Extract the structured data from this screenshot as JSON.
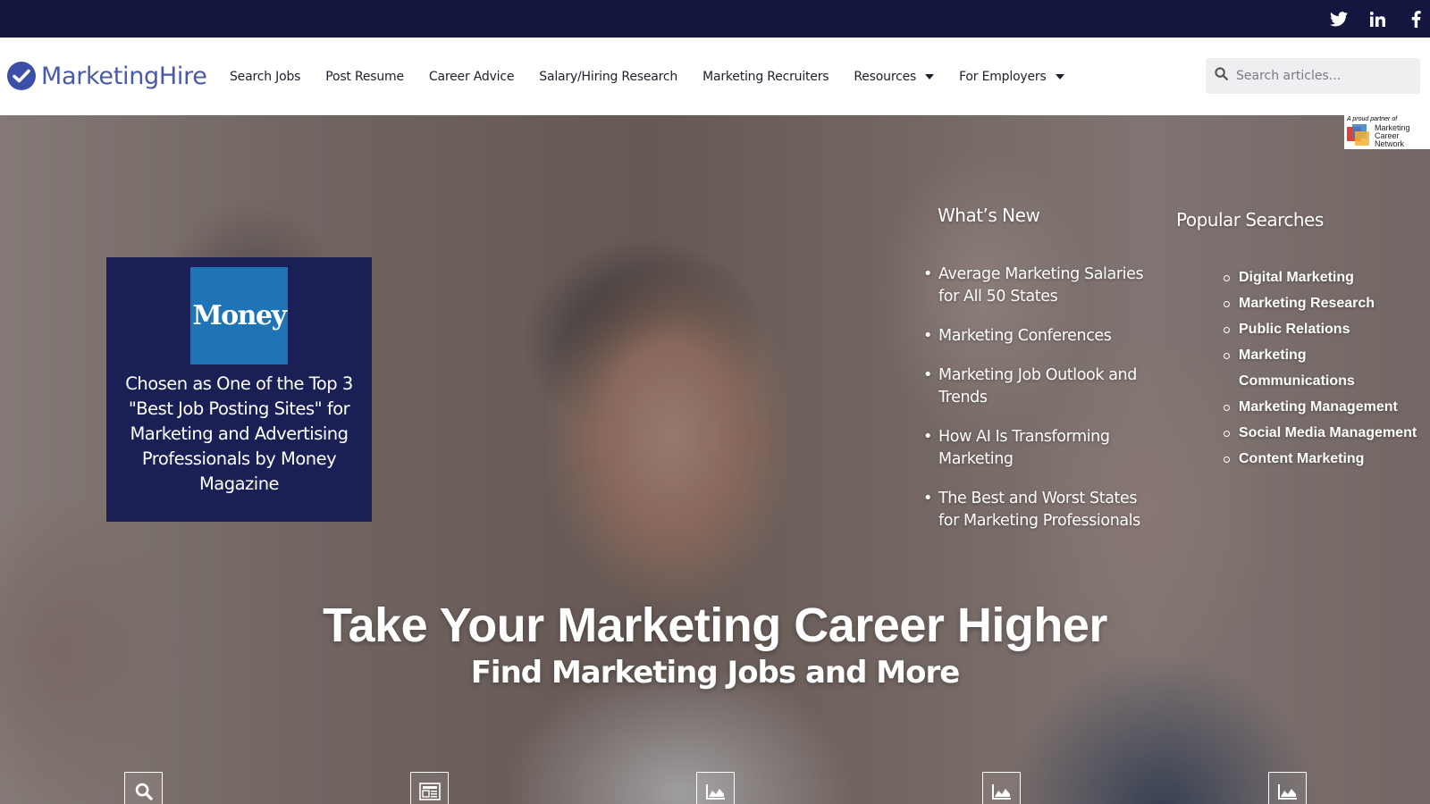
{
  "social": {
    "icons": [
      "twitter-icon",
      "linkedin-icon",
      "facebook-icon"
    ]
  },
  "header": {
    "logo_text": "MarketingHire",
    "nav": [
      {
        "label": "Search Jobs",
        "dropdown": false
      },
      {
        "label": "Post Resume",
        "dropdown": false
      },
      {
        "label": "Career Advice",
        "dropdown": false
      },
      {
        "label": "Salary/Hiring Research",
        "dropdown": false
      },
      {
        "label": "Marketing Recruiters",
        "dropdown": false
      },
      {
        "label": "Resources",
        "dropdown": true
      },
      {
        "label": "For Employers",
        "dropdown": true
      }
    ],
    "search_placeholder": "Search articles..."
  },
  "partner_badge": {
    "top_text": "A proud partner of",
    "lines": [
      "Marketing",
      "Career",
      "Network"
    ]
  },
  "money_card": {
    "logo_text": "Money",
    "text": "Chosen as One of the Top 3 \"Best Job Posting Sites\" for Marketing and Advertising Professionals by Money Magazine"
  },
  "whats_new": {
    "heading": "What’s New",
    "items": [
      "Average Marketing Salaries for All 50 States",
      "Marketing Conferences",
      "Marketing Job Outlook and Trends",
      "How AI Is Transforming Marketing",
      "The Best and Worst States for Marketing Professionals"
    ]
  },
  "popular_searches": {
    "heading": "Popular Searches",
    "items": [
      "Digital Marketing",
      "Marketing Research",
      "Public Relations",
      "Marketing Communications",
      "Marketing Management",
      "Social Media Management",
      "Content Marketing"
    ]
  },
  "hero": {
    "title": "Take Your Marketing Career Higher",
    "subtitle": "Find Marketing Jobs and More"
  },
  "feature_icons": [
    "search-icon",
    "document-icon",
    "area-chart-icon",
    "area-chart-icon",
    "area-chart-icon"
  ],
  "colors": {
    "topbar": "#14163f",
    "brand": "#4a5aa8",
    "card": "#1a2056",
    "money_blue": "#1f74b6"
  }
}
